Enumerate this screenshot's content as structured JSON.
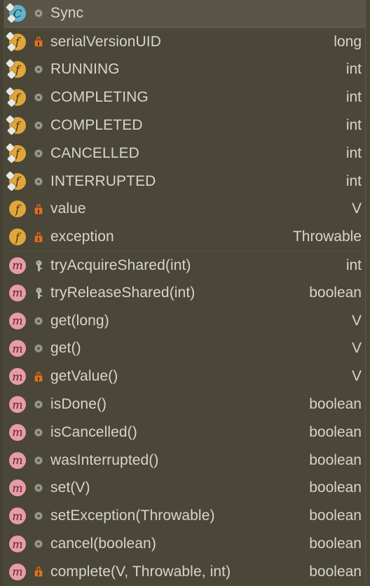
{
  "panel": {
    "name": "structure-view",
    "background": "#4a4638",
    "selected_background": "#5b5547",
    "text_color": "#d7d4cb"
  },
  "rows": [
    {
      "icon": "class-icon",
      "icon_kind": "class",
      "static": true,
      "modifier": "public-icon",
      "label": "Sync",
      "type": "",
      "selected": true,
      "section_start": false
    },
    {
      "icon": "field-icon",
      "icon_kind": "field",
      "static": true,
      "modifier": "lock-icon",
      "label": "serialVersionUID",
      "type": "long",
      "selected": false,
      "section_start": false
    },
    {
      "icon": "field-icon",
      "icon_kind": "field",
      "static": true,
      "modifier": "public-icon",
      "label": "RUNNING",
      "type": "int",
      "selected": false,
      "section_start": false
    },
    {
      "icon": "field-icon",
      "icon_kind": "field",
      "static": true,
      "modifier": "public-icon",
      "label": "COMPLETING",
      "type": "int",
      "selected": false,
      "section_start": false
    },
    {
      "icon": "field-icon",
      "icon_kind": "field",
      "static": true,
      "modifier": "public-icon",
      "label": "COMPLETED",
      "type": "int",
      "selected": false,
      "section_start": false
    },
    {
      "icon": "field-icon",
      "icon_kind": "field",
      "static": true,
      "modifier": "public-icon",
      "label": "CANCELLED",
      "type": "int",
      "selected": false,
      "section_start": false
    },
    {
      "icon": "field-icon",
      "icon_kind": "field",
      "static": true,
      "modifier": "public-icon",
      "label": "INTERRUPTED",
      "type": "int",
      "selected": false,
      "section_start": false
    },
    {
      "icon": "field-icon",
      "icon_kind": "field",
      "static": false,
      "modifier": "lock-icon",
      "label": "value",
      "type": "V",
      "selected": false,
      "section_start": false
    },
    {
      "icon": "field-icon",
      "icon_kind": "field",
      "static": false,
      "modifier": "lock-icon",
      "label": "exception",
      "type": "Throwable",
      "selected": false,
      "section_start": false
    },
    {
      "icon": "method-icon",
      "icon_kind": "method",
      "static": false,
      "modifier": "key-icon",
      "label": "tryAcquireShared(int)",
      "type": "int",
      "selected": false,
      "section_start": true
    },
    {
      "icon": "method-icon",
      "icon_kind": "method",
      "static": false,
      "modifier": "key-icon",
      "label": "tryReleaseShared(int)",
      "type": "boolean",
      "selected": false,
      "section_start": false
    },
    {
      "icon": "method-icon",
      "icon_kind": "method",
      "static": false,
      "modifier": "public-icon",
      "label": "get(long)",
      "type": "V",
      "selected": false,
      "section_start": false
    },
    {
      "icon": "method-icon",
      "icon_kind": "method",
      "static": false,
      "modifier": "public-icon",
      "label": "get()",
      "type": "V",
      "selected": false,
      "section_start": false
    },
    {
      "icon": "method-icon",
      "icon_kind": "method",
      "static": false,
      "modifier": "lock-icon",
      "label": "getValue()",
      "type": "V",
      "selected": false,
      "section_start": false
    },
    {
      "icon": "method-icon",
      "icon_kind": "method",
      "static": false,
      "modifier": "public-icon",
      "label": "isDone()",
      "type": "boolean",
      "selected": false,
      "section_start": false
    },
    {
      "icon": "method-icon",
      "icon_kind": "method",
      "static": false,
      "modifier": "public-icon",
      "label": "isCancelled()",
      "type": "boolean",
      "selected": false,
      "section_start": false
    },
    {
      "icon": "method-icon",
      "icon_kind": "method",
      "static": false,
      "modifier": "public-icon",
      "label": "wasInterrupted()",
      "type": "boolean",
      "selected": false,
      "section_start": false
    },
    {
      "icon": "method-icon",
      "icon_kind": "method",
      "static": false,
      "modifier": "public-icon",
      "label": "set(V)",
      "type": "boolean",
      "selected": false,
      "section_start": false
    },
    {
      "icon": "method-icon",
      "icon_kind": "method",
      "static": false,
      "modifier": "public-icon",
      "label": "setException(Throwable)",
      "type": "boolean",
      "selected": false,
      "section_start": false
    },
    {
      "icon": "method-icon",
      "icon_kind": "method",
      "static": false,
      "modifier": "public-icon",
      "label": "cancel(boolean)",
      "type": "boolean",
      "selected": false,
      "section_start": false
    },
    {
      "icon": "method-icon",
      "icon_kind": "method",
      "static": false,
      "modifier": "lock-icon",
      "label": "complete(V, Throwable, int)",
      "type": "boolean",
      "selected": false,
      "section_start": false
    }
  ],
  "icon_glyphs": {
    "class": "C",
    "field": "f",
    "method": "m"
  }
}
